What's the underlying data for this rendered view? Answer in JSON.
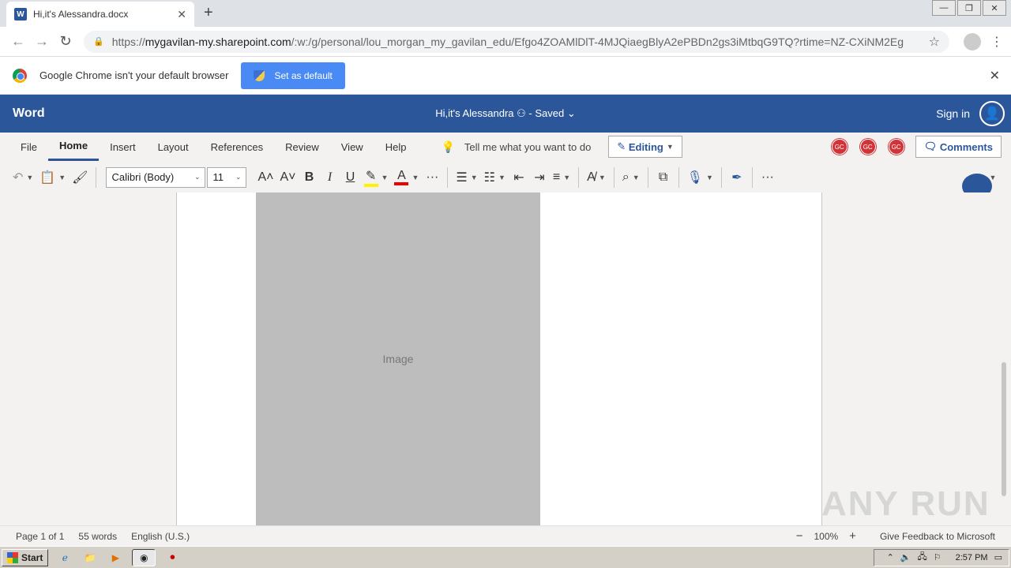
{
  "browser": {
    "tab_title": "Hi,it's Alessandra.docx",
    "url_domain": "mygavilan-my.sharepoint.com",
    "url_rest": "/:w:/g/personal/lou_morgan_my_gavilan_edu/Efgo4ZOAMlDlT-4MJQiaegBlyA2ePBDn2gs3iMtbqG9TQ?rtime=NZ-CXiNM2Eg",
    "url_prefix": "https://"
  },
  "default_bar": {
    "message": "Google Chrome isn't your default browser",
    "button_label": "Set as default"
  },
  "word": {
    "app_name": "Word",
    "doc_title": "Hi,it's Alessandra",
    "doc_status": "Saved",
    "sign_in": "Sign in",
    "tabs": [
      "File",
      "Home",
      "Insert",
      "Layout",
      "References",
      "Review",
      "View",
      "Help"
    ],
    "tell_me": "Tell me what you want to do",
    "editing_label": "Editing",
    "comments_label": "Comments",
    "presence": [
      "GC",
      "GC",
      "GC"
    ],
    "font_name": "Calibri (Body)",
    "font_size": "11",
    "colors": {
      "brand": "#2b579a",
      "highlight": "#fff100",
      "font_color": "#e00000",
      "presence": "#d13438"
    }
  },
  "document": {
    "image_placeholder": "Image"
  },
  "status": {
    "page": "Page 1 of 1",
    "words": "55 words",
    "language": "English (U.S.)",
    "zoom": "100%",
    "feedback": "Give Feedback to Microsoft"
  },
  "watermark": "ANY RUN",
  "taskbar": {
    "start": "Start",
    "clock": "2:57 PM"
  }
}
